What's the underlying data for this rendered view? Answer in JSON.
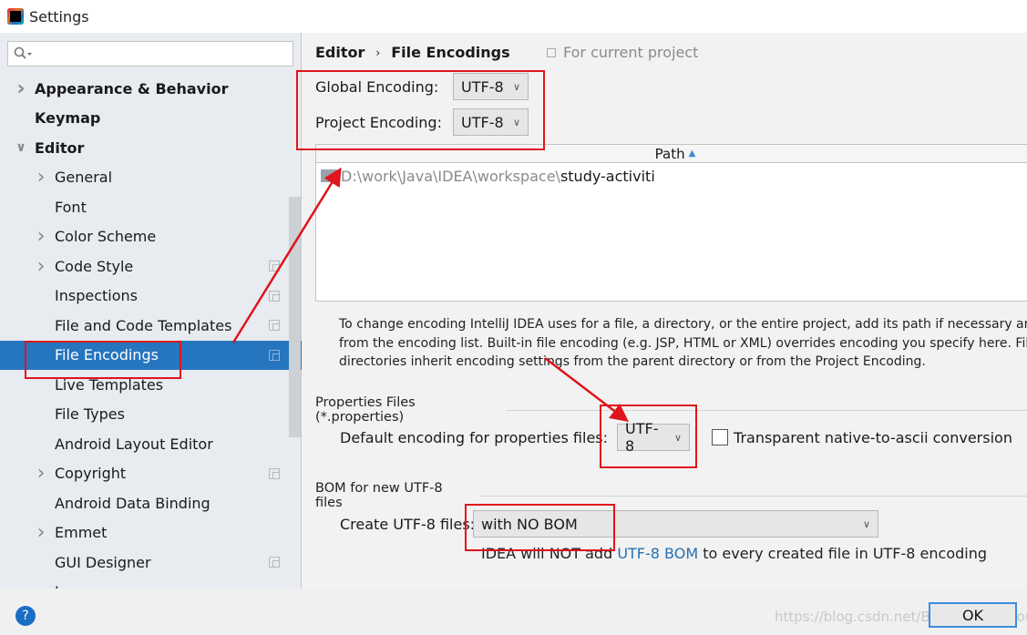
{
  "window": {
    "title": "Settings"
  },
  "search": {
    "placeholder": ""
  },
  "sidebar": {
    "items": [
      {
        "label": "Appearance & Behavior",
        "level": 0,
        "bold": true,
        "chevron": "right"
      },
      {
        "label": "Keymap",
        "level": 0,
        "bold": true,
        "chevron": ""
      },
      {
        "label": "Editor",
        "level": 0,
        "bold": true,
        "chevron": "down"
      },
      {
        "label": "General",
        "level": 1,
        "chevron": "right"
      },
      {
        "label": "Font",
        "level": 1,
        "chevron": ""
      },
      {
        "label": "Color Scheme",
        "level": 1,
        "chevron": "right"
      },
      {
        "label": "Code Style",
        "level": 1,
        "chevron": "right",
        "project": true
      },
      {
        "label": "Inspections",
        "level": 1,
        "chevron": "",
        "project": true
      },
      {
        "label": "File and Code Templates",
        "level": 1,
        "chevron": "",
        "project": true
      },
      {
        "label": "File Encodings",
        "level": 1,
        "chevron": "",
        "project": true,
        "selected": true
      },
      {
        "label": "Live Templates",
        "level": 1,
        "chevron": ""
      },
      {
        "label": "File Types",
        "level": 1,
        "chevron": ""
      },
      {
        "label": "Android Layout Editor",
        "level": 1,
        "chevron": ""
      },
      {
        "label": "Copyright",
        "level": 1,
        "chevron": "right",
        "project": true
      },
      {
        "label": "Android Data Binding",
        "level": 1,
        "chevron": ""
      },
      {
        "label": "Emmet",
        "level": 1,
        "chevron": "right"
      },
      {
        "label": "GUI Designer",
        "level": 1,
        "chevron": "",
        "project": true
      },
      {
        "label": "I",
        "level": 1,
        "chevron": ""
      }
    ]
  },
  "breadcrumb": {
    "parent": "Editor",
    "separator": "›",
    "current": "File Encodings",
    "scope": "For current project"
  },
  "encodings": {
    "global_label": "Global Encoding:",
    "global_value": "UTF-8",
    "project_label": "Project Encoding:",
    "project_value": "UTF-8"
  },
  "table": {
    "column": "Path",
    "rows": [
      {
        "path_prefix": "D:\\work\\Java\\IDEA\\workspace\\",
        "path_name": "study-activiti"
      }
    ]
  },
  "help_text": [
    "To change encoding IntelliJ IDEA uses for a file, a directory, or the entire project, add its path if necessary and then select encoding",
    "from the encoding list. Built-in file encoding (e.g. JSP, HTML or XML) overrides encoding you specify here. Files and",
    "directories inherit encoding settings from the parent directory or from the Project Encoding."
  ],
  "properties": {
    "group_title": "Properties Files (*.properties)",
    "default_label": "Default encoding for properties files:",
    "default_value": "UTF-8",
    "transparent_label": "Transparent native-to-ascii conversion",
    "transparent_checked": false
  },
  "bom": {
    "group_title": "BOM for new UTF-8 files",
    "create_label": "Create UTF-8 files:",
    "create_value": "with NO BOM",
    "note_prefix": "IDEA will NOT add ",
    "note_link": "UTF-8 BOM",
    "note_suffix": " to every created file in UTF-8 encoding"
  },
  "footer": {
    "help": "?",
    "ok": "OK",
    "watermark": "https://blog.csdn.net/Biandan_Weiyou"
  },
  "colors": {
    "selection": "#2675bf",
    "annotation": "#e0141c",
    "link": "#2470b3"
  }
}
